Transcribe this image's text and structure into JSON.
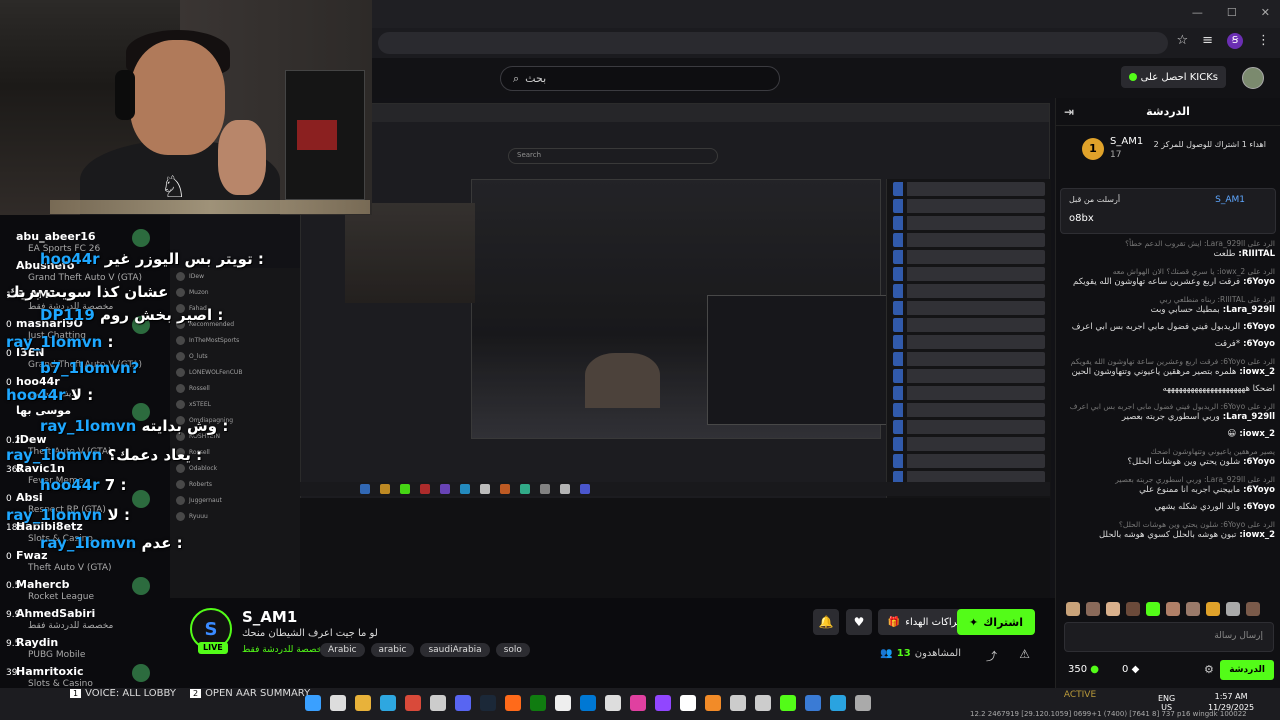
{
  "browser": {
    "search_placeholder": "بحث",
    "get_kicks_label": "احصل على KICKs",
    "extension_badge": "Ꞩ"
  },
  "webcam": {
    "logo_glyph": "♘"
  },
  "overlay": {
    "entries": [
      {
        "rank": "",
        "name": "abu_abeer16",
        "sub": "EA Sports FC 26"
      },
      {
        "rank": "",
        "name": "Abusnefo",
        "sub": "Grand Theft Auto V (GTA)"
      },
      {
        "rank": "13",
        "name": "S_AM1",
        "sub": "مخصصة للدردشة فقط"
      },
      {
        "rank": "0",
        "name": "mashari9O",
        "sub": "Just Chatting"
      },
      {
        "rank": "0",
        "name": "I3EN",
        "sub": "Grand Theft Auto V (GTA)"
      },
      {
        "rank": "0",
        "name": "hoo44r",
        "sub": "لايف شخصي"
      },
      {
        "rank": "",
        "name": "موسى بها",
        "sub": ""
      },
      {
        "rank": "0.2",
        "name": "iDew",
        "sub": "Theft Auto V (GTA)"
      },
      {
        "rank": "367",
        "name": "Ravic1n",
        "sub": "Fever Meme"
      },
      {
        "rank": "0",
        "name": "Absi",
        "sub": "Respect RP (GTA)"
      },
      {
        "rank": "185",
        "name": "Habibi8etz",
        "sub": "Slots & Casino"
      },
      {
        "rank": "0",
        "name": "Fwaz",
        "sub": "Theft Auto V (GTA)"
      },
      {
        "rank": "0.5",
        "name": "Mahercb",
        "sub": "Rocket League"
      },
      {
        "rank": "9.9",
        "name": "AhmedSabiri",
        "sub": "مخصصة للدردشة فقط"
      },
      {
        "rank": "9.5",
        "name": "Raydin",
        "sub": "PUBG Mobile"
      },
      {
        "rank": "39",
        "name": "Hamritoxic",
        "sub": "Slots & Casino"
      }
    ],
    "big_messages": [
      {
        "user": "hoo44r",
        "text": "تويتر بس اليوزر غير :"
      },
      {
        "user": "",
        "text": "عشان كذا سويت بريك"
      },
      {
        "user": "DP119",
        "text": "اصير بخش روم :"
      },
      {
        "user": "ray_1lomvn",
        "text": ":"
      },
      {
        "user": "b7_1lomvn?",
        "text": ""
      },
      {
        "user": "hoo44r",
        "text": "لا :"
      },
      {
        "user": "ray_1lomvn",
        "text": "وش بدايته :"
      },
      {
        "user": "ray_1lomvn",
        "text": "يعاد دعمك؟ :"
      },
      {
        "user": "hoo44r",
        "text": "7 :"
      },
      {
        "user": "ray_1lomvn",
        "text": "لا :"
      },
      {
        "user": "ray_1lomvn",
        "text": "عدم :"
      }
    ]
  },
  "stream": {
    "inner_search": "Search",
    "inner_sidebar": [
      "IDew",
      "Muzon",
      "Fahad",
      "Recommended",
      "InTheMostSports",
      "O_luts",
      "LONEWOLFenCUB",
      "Rossell",
      "xSTEEL",
      "Omdiapagning",
      "ROSHTEIN",
      "Rossell",
      "Odablock",
      "Roberts",
      "Juggernaut",
      "Ryuuu"
    ]
  },
  "info": {
    "streamer": "S_AM1",
    "avatar_letter": "S",
    "live": "LIVE",
    "title": "لو ما جيت اعرف الشيطان منحك",
    "category": "مخصصة للدردشة فقط",
    "tags": [
      "Arabic",
      "arabic",
      "saudiArabia",
      "solo"
    ],
    "subscribe": "اشتراك",
    "gift_subs": "الاشتراكات الهداء",
    "viewers_label": "المشاهدون",
    "viewers_count": "13"
  },
  "chat": {
    "header": "الدردشة",
    "top_gifter": "S_AM1",
    "top_gifter_count": "17",
    "top_gifter_rank": "1",
    "goal": "اهداء 1 اشتراك للوصول للمركز 2",
    "pinned_user": "S_AM1",
    "pinned_label": "أرسلت من قبل",
    "pinned_text": "o8bx",
    "messages": [
      {
        "reply": "الرد على Lara_929ll: ايش تقروب الدعم خطأ؟",
        "user": "RIIITAL:",
        "text": "طلعت"
      },
      {
        "reply": "الرد على 2_iowx: يا سري قصتك؟ الان الهواش معه",
        "user": "6Yoyo:",
        "text": "فرقت اربع وعشرين ساعه تهاوشون الله يقويكم"
      },
      {
        "reply": "الرد على RIIITAL: ربناه منطلعي ربي",
        "user": "Lara_929ll:",
        "text": "بمطيك حسابي وبت"
      },
      {
        "reply": "",
        "user": "6Yoyo:",
        "text": "الريدبول فيني فضول مابي اجربه بس ابي اعرف"
      },
      {
        "reply": "",
        "user": "6Yoyo:",
        "text": "*فرقت"
      },
      {
        "reply": "الرد على 6Yoyo: فرقت اربع وعشرين ساعة تهاوشون الله يقويكم",
        "user": "2_iowx:",
        "text": "هلمره بتصير مرهقين ياعيوني وتتهاوشون الحين"
      },
      {
        "reply": "",
        "user": "",
        "text": "اضحكا هههههههههههههههههههههه"
      },
      {
        "reply": "الرد على 6Yoyo: الريدبول فيني فضول مابي اجربه بس ابي اعرف",
        "user": "Lara_929ll:",
        "text": "وربي اسطوري جربته بعصير"
      },
      {
        "reply": "",
        "user": "2_iowx:",
        "text": "😀"
      },
      {
        "reply": "يصير مرهقين ياعيوني وتتهاوشون اضحك",
        "user": "6Yoyo:",
        "text": "شلون يحتي وين هوشات الحلل؟"
      },
      {
        "reply": "الرد على Lara_929ll: وربي اسطوري جربته بعصير",
        "user": "6Yoyo:",
        "text": "مابيجني اجربه انا ممنوع علي"
      },
      {
        "reply": "",
        "user": "6Yoyo:",
        "text": "والد الوردي شكله يشهي"
      },
      {
        "reply": "الرد على 6Yoyo: شلون يحتي وين هوشات الحلل؟",
        "user": "2_iowx:",
        "text": "تبون هوشه بالحلل كسوي هوشه بالحلل"
      }
    ],
    "input_placeholder": "إرسال رسالة",
    "send_label": "الدردشة",
    "points": "350",
    "kicks": "0"
  },
  "taskbar": {
    "tabs": [
      {
        "num": "1",
        "label": "VOICE: ALL LOBBY"
      },
      {
        "num": "2",
        "label": "OPEN AAR SUMMARY"
      }
    ],
    "status": "ACTIVE",
    "lang_top": "ENG",
    "lang_bottom": "US",
    "time": "1:57 AM",
    "date": "11/29/2025",
    "coords": "12.2 2467919 [29.120.1059] 0699+1 (7400) [7641 8] 737 p16 wingdk 100022"
  },
  "colors": {
    "kick_green": "#53fc18",
    "username_blue": "#1ea7ff",
    "gold": "#e0a22a"
  }
}
